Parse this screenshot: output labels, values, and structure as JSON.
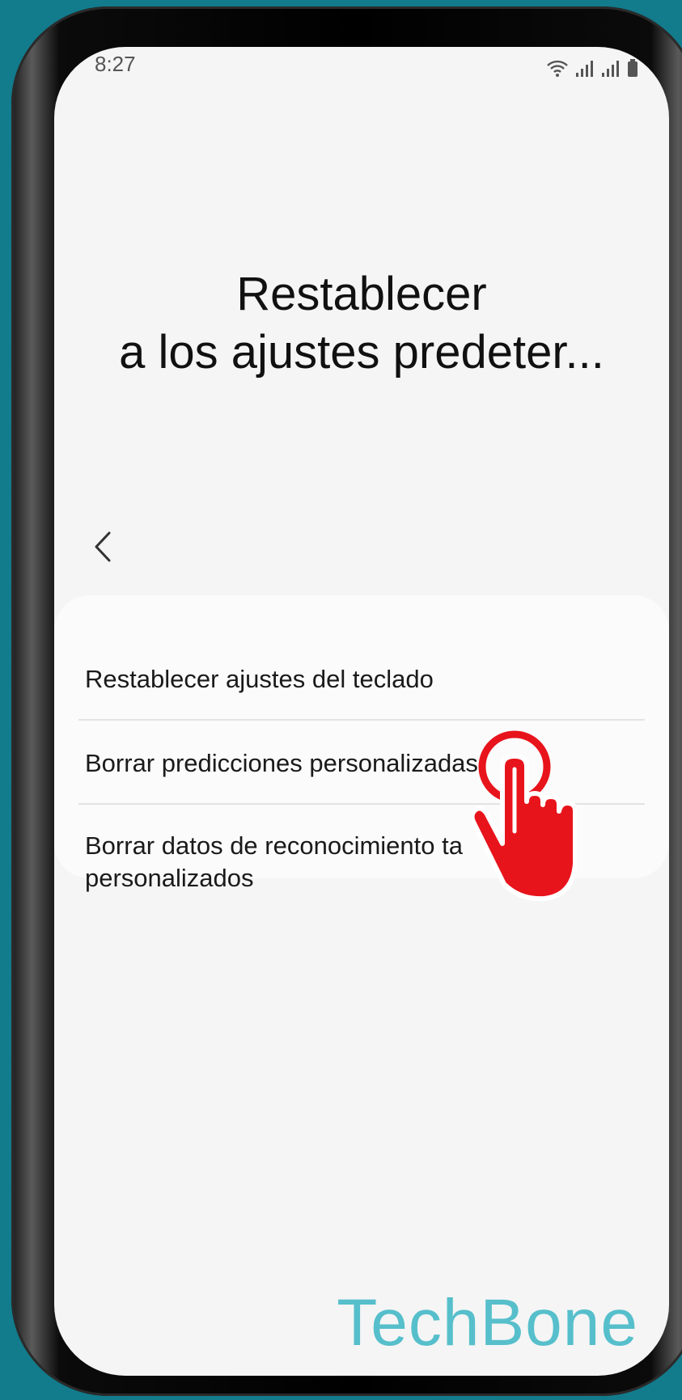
{
  "status_bar": {
    "time": "8:27",
    "icons": [
      "wifi-icon",
      "signal-1-icon",
      "signal-2-icon",
      "battery-icon"
    ]
  },
  "page": {
    "title_line1": "Restablecer",
    "title_line2": "a los ajustes predeter..."
  },
  "back_button": {
    "icon": "chevron-left-icon"
  },
  "menu": {
    "items": [
      {
        "label": "Restablecer ajustes del teclado"
      },
      {
        "label": "Borrar predicciones personalizadas"
      },
      {
        "label_line1": "Borrar datos de reconocimiento ta",
        "label_line2": "personalizados"
      }
    ]
  },
  "overlay": {
    "tap_indicator_icon": "tap-hand-icon",
    "color": "#e8141c"
  },
  "watermark": {
    "text": "TechBone",
    "color": "#56bfcb"
  }
}
